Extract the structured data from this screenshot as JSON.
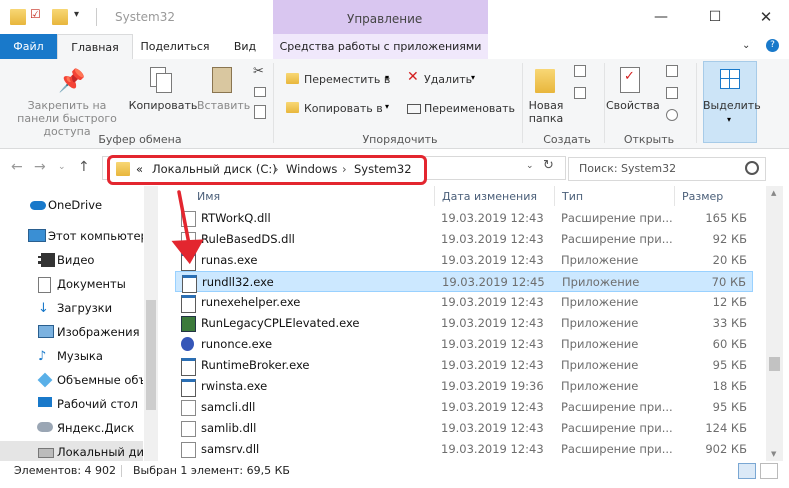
{
  "window": {
    "title": "System32",
    "manage_label": "Управление"
  },
  "tabs": [
    {
      "label": "Файл"
    },
    {
      "label": "Главная"
    },
    {
      "label": "Поделиться"
    },
    {
      "label": "Вид"
    },
    {
      "label": "Средства работы с приложениями"
    }
  ],
  "ribbon": {
    "pin_label": "Закрепить на панели быстрого доступа",
    "copy_label": "Копировать",
    "paste_label": "Вставить",
    "clipboard_group": "Буфер обмена",
    "move_to": "Переместить в",
    "copy_to": "Копировать в",
    "delete": "Удалить",
    "rename": "Переименовать",
    "organize_group": "Упорядочить",
    "new_folder": "Новая папка",
    "create_group": "Создать",
    "properties": "Свойства",
    "open_group": "Открыть",
    "select": "Выделить"
  },
  "address": {
    "prefix": "«",
    "crumbs": [
      "Локальный диск (C:)",
      "Windows",
      "System32"
    ],
    "search_placeholder": "Поиск: System32"
  },
  "nav": [
    {
      "label": "OneDrive",
      "icon": "cloud-icon"
    },
    {
      "label": "Этот компьютер",
      "icon": "computer-icon"
    },
    {
      "label": "Видео",
      "icon": "video-icon"
    },
    {
      "label": "Документы",
      "icon": "documents-icon"
    },
    {
      "label": "Загрузки",
      "icon": "download-icon"
    },
    {
      "label": "Изображения",
      "icon": "pictures-icon"
    },
    {
      "label": "Музыка",
      "icon": "music-icon"
    },
    {
      "label": "Объемные объ",
      "icon": "3d-objects-icon"
    },
    {
      "label": "Рабочий стол",
      "icon": "desktop-icon"
    },
    {
      "label": "Яндекс.Диск",
      "icon": "yandex-disk-icon"
    },
    {
      "label": "Локальный дис",
      "icon": "drive-icon"
    }
  ],
  "columns": {
    "name": "Имя",
    "date": "Дата изменения",
    "type": "Тип",
    "size": "Размер"
  },
  "files": [
    {
      "name": "RTWorkQ.dll",
      "date": "19.03.2019 12:43",
      "type": "Расширение при...",
      "size": "165 КБ",
      "kind": "dll"
    },
    {
      "name": "RuleBasedDS.dll",
      "date": "19.03.2019 12:43",
      "type": "Расширение при...",
      "size": "92 КБ",
      "kind": "dll"
    },
    {
      "name": "runas.exe",
      "date": "19.03.2019 12:43",
      "type": "Приложение",
      "size": "20 КБ",
      "kind": "exe"
    },
    {
      "name": "rundll32.exe",
      "date": "19.03.2019 12:45",
      "type": "Приложение",
      "size": "70 КБ",
      "kind": "exe"
    },
    {
      "name": "runexehelper.exe",
      "date": "19.03.2019 12:43",
      "type": "Приложение",
      "size": "12 КБ",
      "kind": "exe"
    },
    {
      "name": "RunLegacyCPLElevated.exe",
      "date": "19.03.2019 12:43",
      "type": "Приложение",
      "size": "33 КБ",
      "kind": "exe2"
    },
    {
      "name": "runonce.exe",
      "date": "19.03.2019 12:43",
      "type": "Приложение",
      "size": "60 КБ",
      "kind": "exe3"
    },
    {
      "name": "RuntimeBroker.exe",
      "date": "19.03.2019 12:43",
      "type": "Приложение",
      "size": "95 КБ",
      "kind": "exe"
    },
    {
      "name": "rwinsta.exe",
      "date": "19.03.2019 19:36",
      "type": "Приложение",
      "size": "18 КБ",
      "kind": "exe"
    },
    {
      "name": "samcli.dll",
      "date": "19.03.2019 12:43",
      "type": "Расширение при...",
      "size": "95 КБ",
      "kind": "dll"
    },
    {
      "name": "samlib.dll",
      "date": "19.03.2019 12:43",
      "type": "Расширение при...",
      "size": "124 КБ",
      "kind": "dll"
    },
    {
      "name": "samsrv.dll",
      "date": "19.03.2019 12:43",
      "type": "Расширение при...",
      "size": "902 КБ",
      "kind": "dll"
    }
  ],
  "selected_index": 3,
  "status": {
    "count": "Элементов: 4 902",
    "selection": "Выбран 1 элемент: 69,5 КБ"
  }
}
